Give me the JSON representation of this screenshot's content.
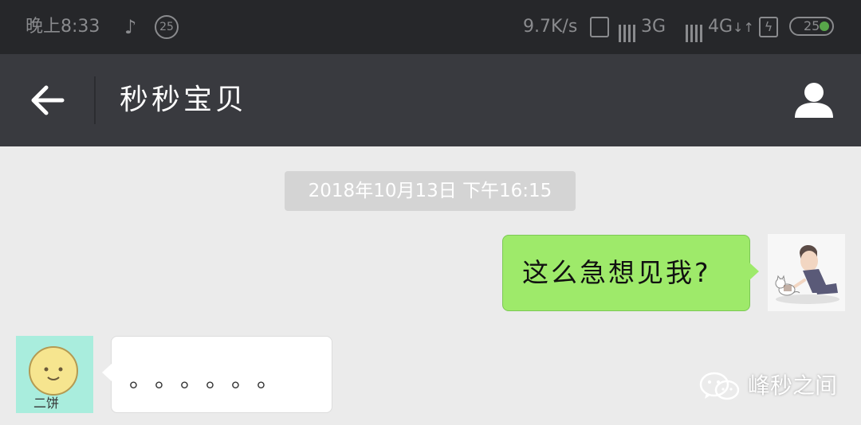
{
  "status_bar": {
    "time": "晚上8:33",
    "music_icon": "music-note-icon",
    "notification_count": "25",
    "network_speed": "9.7K/s",
    "sim1_type": "3G",
    "sim2_type": "4G",
    "data_arrows": "↓↑",
    "battery_level": "25",
    "color": "#8a8b8e"
  },
  "header": {
    "title": "秒秒宝贝",
    "back_icon": "back-arrow-icon",
    "profile_icon": "person-icon",
    "background": "#393a3f"
  },
  "chat": {
    "timestamp": "2018年10月13日 下午16:15",
    "messages": [
      {
        "side": "right",
        "text": "这么急想见我?",
        "bubble_color": "#9eea6a"
      },
      {
        "side": "left",
        "text": "。。。。。。",
        "bubble_color": "#ffffff",
        "avatar_caption": "二饼"
      }
    ]
  },
  "watermark": {
    "icon": "wechat-icon",
    "text": "峰秒之间"
  }
}
